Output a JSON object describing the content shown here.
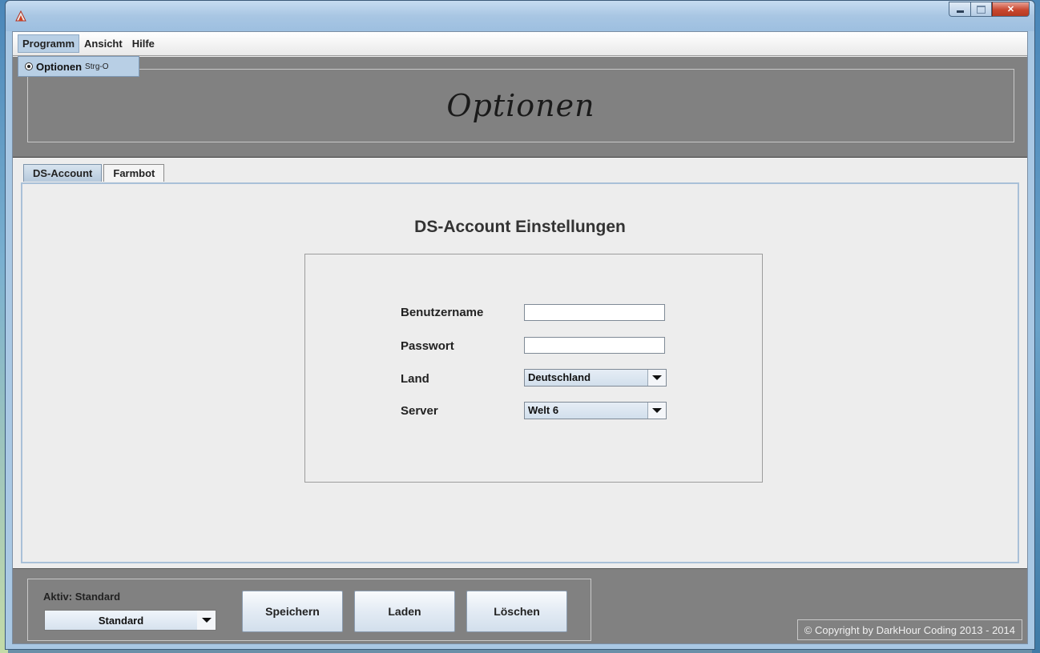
{
  "menubar": {
    "items": [
      "Programm",
      "Ansicht",
      "Hilfe"
    ]
  },
  "dropdown": {
    "label": "Optionen",
    "accelerator": "Strg-O"
  },
  "header": {
    "title": "Optionen"
  },
  "tabs": [
    "DS-Account",
    "Farmbot"
  ],
  "panel": {
    "title": "DS-Account Einstellungen",
    "username_label": "Benutzername",
    "username_value": "",
    "password_label": "Passwort",
    "password_value": "",
    "country_label": "Land",
    "country_value": "Deutschland",
    "server_label": "Server",
    "server_value": "Welt 6"
  },
  "bottom": {
    "aktiv_label": "Aktiv: Standard",
    "profile_value": "Standard",
    "save_label": "Speichern",
    "load_label": "Laden",
    "delete_label": "Löschen",
    "copyright": "© Copyright by DarkHour Coding 2013 - 2014"
  },
  "colors": {
    "header_bg": "#818181",
    "tab_selected": "#b6c9dc",
    "window_frame": "#a9c8e4"
  },
  "icons": {
    "app": "app-logo-icon",
    "minimize": "minimize-icon",
    "maximize": "maximize-icon",
    "close": "close-icon"
  }
}
